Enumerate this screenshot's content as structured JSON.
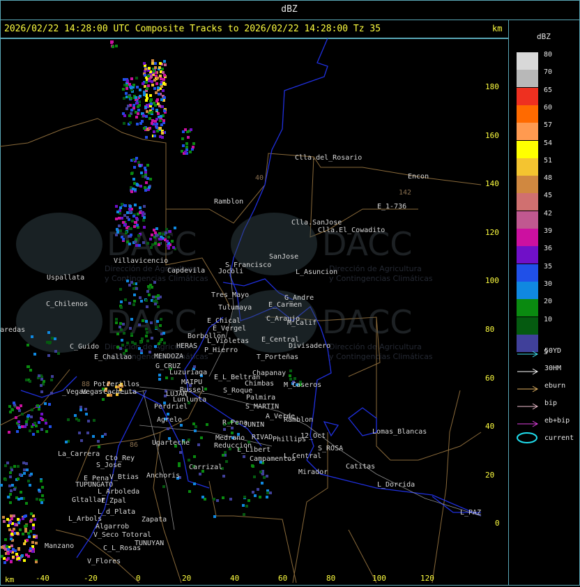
{
  "window": {
    "top_label": "dBZ"
  },
  "title": {
    "text": "2026/02/22 14:28:00 UTC Composite Tracks to 2026/02/22 14:28:00 Tz 35",
    "unit": "km"
  },
  "legend": {
    "title": "dBZ",
    "levels": [
      {
        "label": "80",
        "color": "#d8d8d8"
      },
      {
        "label": "70",
        "color": "#b8b8b8"
      },
      {
        "label": "65",
        "color": "#ee3020"
      },
      {
        "label": "60",
        "color": "#ff6a00"
      },
      {
        "label": "57",
        "color": "#ff9a50"
      },
      {
        "label": "54",
        "color": "#ffff00"
      },
      {
        "label": "51",
        "color": "#f4c430"
      },
      {
        "label": "48",
        "color": "#d08840"
      },
      {
        "label": "45",
        "color": "#d07070"
      },
      {
        "label": "42",
        "color": "#c05890"
      },
      {
        "label": "39",
        "color": "#cc10a0"
      },
      {
        "label": "36",
        "color": "#7010c8"
      },
      {
        "label": "35",
        "color": "#2050e8"
      },
      {
        "label": "30",
        "color": "#1088e0"
      },
      {
        "label": "20",
        "color": "#0a8a10"
      },
      {
        "label": "10",
        "color": "#055a10"
      },
      {
        "label": "5",
        "color": "#40409a"
      }
    ],
    "tracks": [
      {
        "label": "50YD",
        "color": "#40e0f0"
      },
      {
        "label": "30HM",
        "color": "#ffffff"
      },
      {
        "label": "eburn",
        "color": "#e0b060"
      },
      {
        "label": "bip",
        "color": "#f0c0d0"
      },
      {
        "label": "eb+bip",
        "color": "#e040e0"
      },
      {
        "label": "current",
        "color": "#20e0f0"
      }
    ]
  },
  "axes": {
    "y_ticks": [
      "180",
      "160",
      "140",
      "120",
      "100",
      "80",
      "60",
      "40",
      "20",
      "0"
    ],
    "x_ticks": [
      "-40",
      "-20",
      "0",
      "20",
      "40",
      "60",
      "80",
      "100",
      "120"
    ],
    "x_unit": "km"
  },
  "watermark": {
    "brand": "DACC",
    "line1": "Dirección de Agricultura",
    "line2": "y Contingencias Climáticas"
  },
  "places": [
    {
      "name": "Clla.del_Rosario"
    },
    {
      "name": "Encon"
    },
    {
      "name": "142"
    },
    {
      "name": "E_1-736"
    },
    {
      "name": "Ramblon"
    },
    {
      "name": "Clla.SanJose"
    },
    {
      "name": "Clla.El_Cowadito"
    },
    {
      "name": "Villavicencio"
    },
    {
      "name": "Uspallata"
    },
    {
      "name": "Capdevila"
    },
    {
      "name": "S_Francisco"
    },
    {
      "name": "SanJose"
    },
    {
      "name": "L_Asuncion"
    },
    {
      "name": "Jocoli"
    },
    {
      "name": "Tres_Mayo"
    },
    {
      "name": "G_Andre"
    },
    {
      "name": "E_Carmen"
    },
    {
      "name": "C_Chilenos"
    },
    {
      "name": "Tulumaya"
    },
    {
      "name": "E_Chical"
    },
    {
      "name": "C_Araujo"
    },
    {
      "name": "M_Calif"
    },
    {
      "name": "E_Vergel"
    },
    {
      "name": "aredas"
    },
    {
      "name": "Borbollon"
    },
    {
      "name": "E_Central"
    },
    {
      "name": "L_Violetas"
    },
    {
      "name": "Divisadero"
    },
    {
      "name": "C_Guido"
    },
    {
      "name": "HERAS"
    },
    {
      "name": "P_Hierro"
    },
    {
      "name": "E_Challao"
    },
    {
      "name": "MENDOZA"
    },
    {
      "name": "T_Porteñas"
    },
    {
      "name": "G_CRUZ"
    },
    {
      "name": "Luzuriaga"
    },
    {
      "name": "Chapanay"
    },
    {
      "name": "E_L_Beltran"
    },
    {
      "name": "MAIPU"
    },
    {
      "name": "Chimbas"
    },
    {
      "name": "M_Caseros"
    },
    {
      "name": "Potrerillos"
    },
    {
      "name": "Russel"
    },
    {
      "name": "S_Roque"
    },
    {
      "name": "Vegas"
    },
    {
      "name": "Cacheuta"
    },
    {
      "name": "LUJAN"
    },
    {
      "name": "Palmira"
    },
    {
      "name": "Lunlunta"
    },
    {
      "name": "S_MARTIN"
    },
    {
      "name": "Perdriel"
    },
    {
      "name": "A_Verde"
    },
    {
      "name": "Ramblon"
    },
    {
      "name": "Agrelo"
    },
    {
      "name": "R_Pena"
    },
    {
      "name": "JUNIN"
    },
    {
      "name": "Lomas_Blancas"
    },
    {
      "name": "12_Oct"
    },
    {
      "name": "Ugarteche"
    },
    {
      "name": "Medrano"
    },
    {
      "name": "RIVAD"
    },
    {
      "name": "Phillips"
    },
    {
      "name": "Reduccion"
    },
    {
      "name": "S_ROSA"
    },
    {
      "name": "L_Libert"
    },
    {
      "name": "L_Central"
    },
    {
      "name": "La_Carrera"
    },
    {
      "name": "Cto_Rey"
    },
    {
      "name": "Campamentos"
    },
    {
      "name": "Catitas"
    },
    {
      "name": "S_Jose"
    },
    {
      "name": "Carrizal"
    },
    {
      "name": "Anchoris"
    },
    {
      "name": "Mirador"
    },
    {
      "name": "E_Pena"
    },
    {
      "name": "V_Btias"
    },
    {
      "name": "TUPUNGATO"
    },
    {
      "name": "L_Dorrida"
    },
    {
      "name": "L_Arboleda"
    },
    {
      "name": "Gltallar"
    },
    {
      "name": "E_Zpal"
    },
    {
      "name": "L_d_Plata"
    },
    {
      "name": "L_Arbols"
    },
    {
      "name": "Zapata"
    },
    {
      "name": "L_PAZ"
    },
    {
      "name": "Algarrob"
    },
    {
      "name": "V_Seco"
    },
    {
      "name": "Totoral"
    },
    {
      "name": "TUNUYAN"
    },
    {
      "name": "Manzano"
    },
    {
      "name": "C_L_Rosas"
    },
    {
      "name": "V_Flores"
    },
    {
      "name": "40"
    },
    {
      "name": "88"
    },
    {
      "name": "86"
    },
    {
      "name": "_Vegas"
    }
  ]
}
